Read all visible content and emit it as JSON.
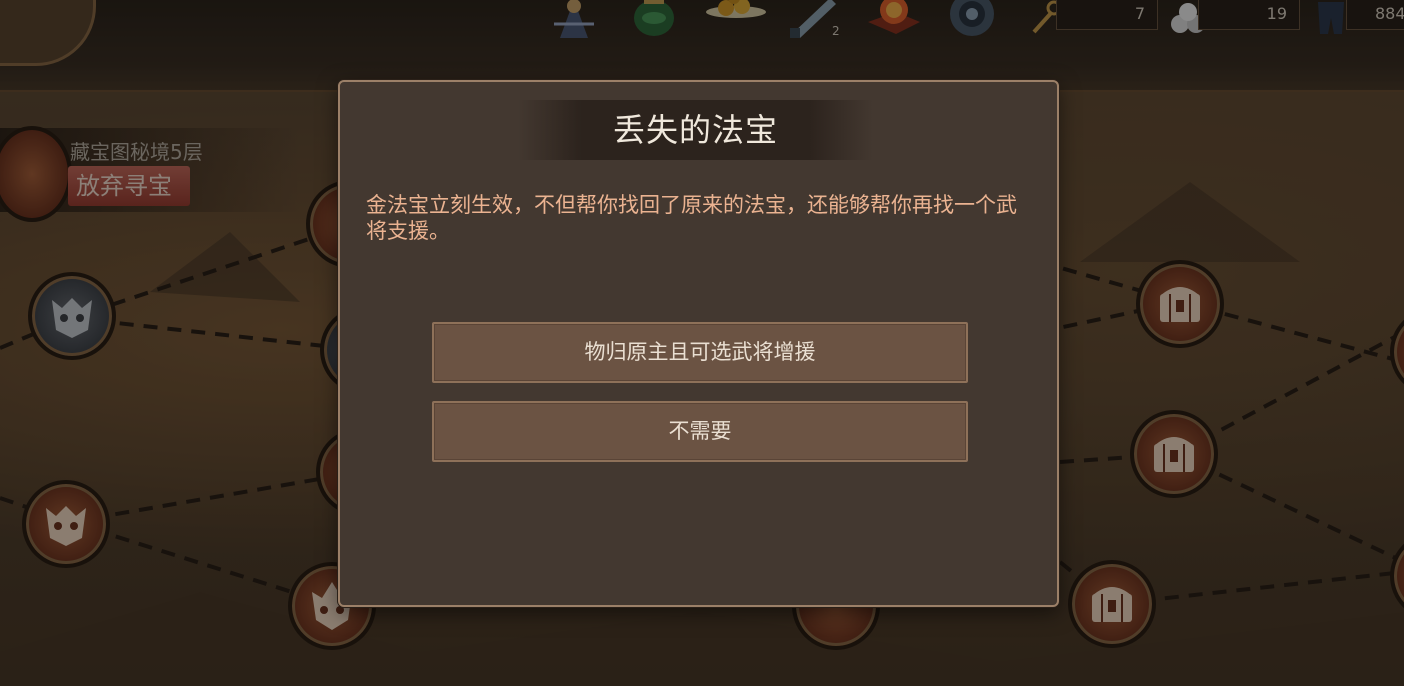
{
  "resources": [
    {
      "icon": "key-icon",
      "value": "7"
    },
    {
      "icon": "silver-ore-icon",
      "value": "19"
    },
    {
      "icon": "armor-icon",
      "value": "884"
    }
  ],
  "items": [
    {
      "icon": "general-figure-icon",
      "count": ""
    },
    {
      "icon": "green-vase-icon",
      "count": ""
    },
    {
      "icon": "gold-ingots-icon",
      "count": ""
    },
    {
      "icon": "blade-icon",
      "count": "2"
    },
    {
      "icon": "orb-seal-icon",
      "count": ""
    },
    {
      "icon": "disc-medal-icon",
      "count": ""
    }
  ],
  "floor": {
    "title": "藏宝图秘境5层",
    "abandon_label": "放弃寻宝"
  },
  "dialog": {
    "title": "丢失的法宝",
    "body": "金法宝立刻生效，不但帮你找回了原来的法宝，还能够帮你再找一个武将支援。",
    "confirm_label": "物归原主且可选武将增援",
    "decline_label": "不需要"
  },
  "colors": {
    "dialog_bg": "#433830",
    "body_text": "#ebb391",
    "button_bg": "#6b5343",
    "abandon_bg": "#b0544a"
  }
}
